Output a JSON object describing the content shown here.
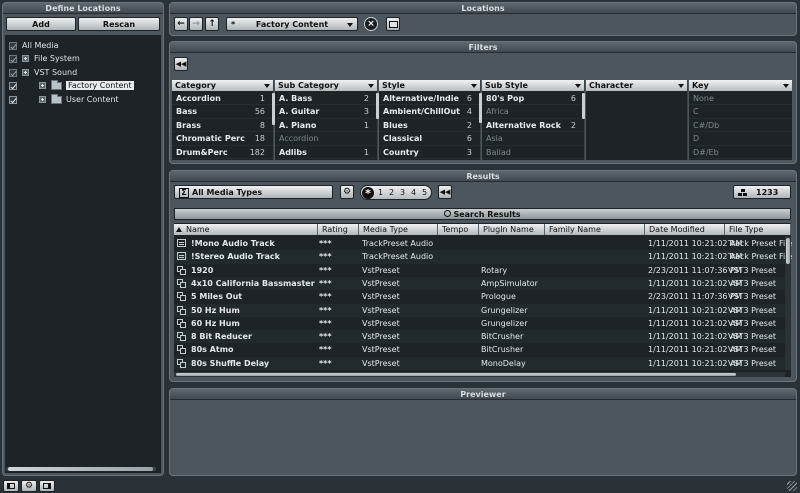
{
  "define_locations": {
    "title": "Define Locations",
    "add_label": "Add",
    "rescan_label": "Rescan",
    "tree": [
      {
        "label": "All Media"
      },
      {
        "label": "File System"
      },
      {
        "label": "VST Sound"
      },
      {
        "label": "Factory Content"
      },
      {
        "label": "User Content"
      }
    ]
  },
  "locations": {
    "title": "Locations",
    "back_icon": "arrow-left-icon",
    "forward_icon": "arrow-right-icon",
    "up_icon": "arrow-up-icon",
    "star": "*",
    "selected": "Factory Content"
  },
  "filters": {
    "title": "Filters",
    "columns": [
      {
        "header": "Category",
        "rows": [
          [
            "Accordion",
            "1"
          ],
          [
            "Bass",
            "56"
          ],
          [
            "Brass",
            "8"
          ],
          [
            "Chromatic Perc",
            "18"
          ],
          [
            "Drum&Perc",
            "182"
          ]
        ]
      },
      {
        "header": "Sub Category",
        "rows": [
          [
            "A. Bass",
            "2"
          ],
          [
            "A. Guitar",
            "3"
          ],
          [
            "A. Piano",
            "1"
          ],
          [
            "Accordion",
            ""
          ],
          [
            "Adlibs",
            "1"
          ]
        ]
      },
      {
        "header": "Style",
        "rows": [
          [
            "Alternative/Indie",
            "6"
          ],
          [
            "Ambient/ChillOut",
            "4"
          ],
          [
            "Blues",
            "2"
          ],
          [
            "Classical",
            "6"
          ],
          [
            "Country",
            "3"
          ]
        ]
      },
      {
        "header": "Sub Style",
        "rows": [
          [
            "80's Pop",
            "6"
          ],
          [
            "Africa",
            ""
          ],
          [
            "Alternative Rock",
            "2"
          ],
          [
            "Asia",
            ""
          ],
          [
            "Ballad",
            ""
          ]
        ]
      },
      {
        "header": "Character",
        "rows": []
      },
      {
        "header": "Key",
        "rows": [
          [
            "None",
            ""
          ],
          [
            "C",
            ""
          ],
          [
            "C#/Db",
            ""
          ],
          [
            "D",
            ""
          ],
          [
            "D#/Eb",
            ""
          ]
        ]
      }
    ]
  },
  "results": {
    "title": "Results",
    "media_type": "All Media Types",
    "rating_filter": "*",
    "rating_levels": [
      "1",
      "2",
      "3",
      "4",
      "5"
    ],
    "count": "1233",
    "search_label": "Search Results",
    "columns": [
      "Name",
      "Rating",
      "Media Type",
      "Tempo",
      "PlugIn Name",
      "Family Name",
      "Date Modified",
      "File Type"
    ],
    "rows": [
      {
        "icon": "track",
        "name": "!Mono Audio Track",
        "rating": "***",
        "media": "TrackPreset Audio",
        "tempo": "",
        "plugin": "",
        "family": "",
        "date": "1/11/2011 10:21:02 AM",
        "ftype": "Track Preset File"
      },
      {
        "icon": "track",
        "name": "!Stereo Audio Track",
        "rating": "***",
        "media": "TrackPreset Audio",
        "tempo": "",
        "plugin": "",
        "family": "",
        "date": "1/11/2011 10:21:02 AM",
        "ftype": "Track Preset File"
      },
      {
        "icon": "vst",
        "name": "1920",
        "rating": "***",
        "media": "VstPreset",
        "tempo": "",
        "plugin": "Rotary",
        "family": "",
        "date": "2/23/2011 11:07:36 PM",
        "ftype": "VST3 Preset"
      },
      {
        "icon": "vst",
        "name": "4x10 California Bassmaster",
        "rating": "***",
        "media": "VstPreset",
        "tempo": "",
        "plugin": "AmpSimulator",
        "family": "",
        "date": "1/11/2011 10:21:02 AM",
        "ftype": "VST3 Preset"
      },
      {
        "icon": "vst",
        "name": "5 Miles Out",
        "rating": "***",
        "media": "VstPreset",
        "tempo": "",
        "plugin": "Prologue",
        "family": "",
        "date": "2/23/2011 11:07:36 PM",
        "ftype": "VST3 Preset"
      },
      {
        "icon": "vst",
        "name": "50 Hz Hum",
        "rating": "***",
        "media": "VstPreset",
        "tempo": "",
        "plugin": "Grungelizer",
        "family": "",
        "date": "1/11/2011 10:21:02 AM",
        "ftype": "VST3 Preset"
      },
      {
        "icon": "vst",
        "name": "60 Hz Hum",
        "rating": "***",
        "media": "VstPreset",
        "tempo": "",
        "plugin": "Grungelizer",
        "family": "",
        "date": "1/11/2011 10:21:02 AM",
        "ftype": "VST3 Preset"
      },
      {
        "icon": "vst",
        "name": "8 Bit Reducer",
        "rating": "***",
        "media": "VstPreset",
        "tempo": "",
        "plugin": "BitCrusher",
        "family": "",
        "date": "1/11/2011 10:21:02 AM",
        "ftype": "VST3 Preset"
      },
      {
        "icon": "vst",
        "name": "80s Atmo",
        "rating": "***",
        "media": "VstPreset",
        "tempo": "",
        "plugin": "BitCrusher",
        "family": "",
        "date": "1/11/2011 10:21:02 AM",
        "ftype": "VST3 Preset"
      },
      {
        "icon": "vst",
        "name": "80s Shuffle Delay",
        "rating": "***",
        "media": "VstPreset",
        "tempo": "",
        "plugin": "MonoDelay",
        "family": "",
        "date": "1/11/2011 10:21:02 AM",
        "ftype": "VST3 Preset"
      }
    ]
  },
  "previewer": {
    "title": "Previewer"
  }
}
